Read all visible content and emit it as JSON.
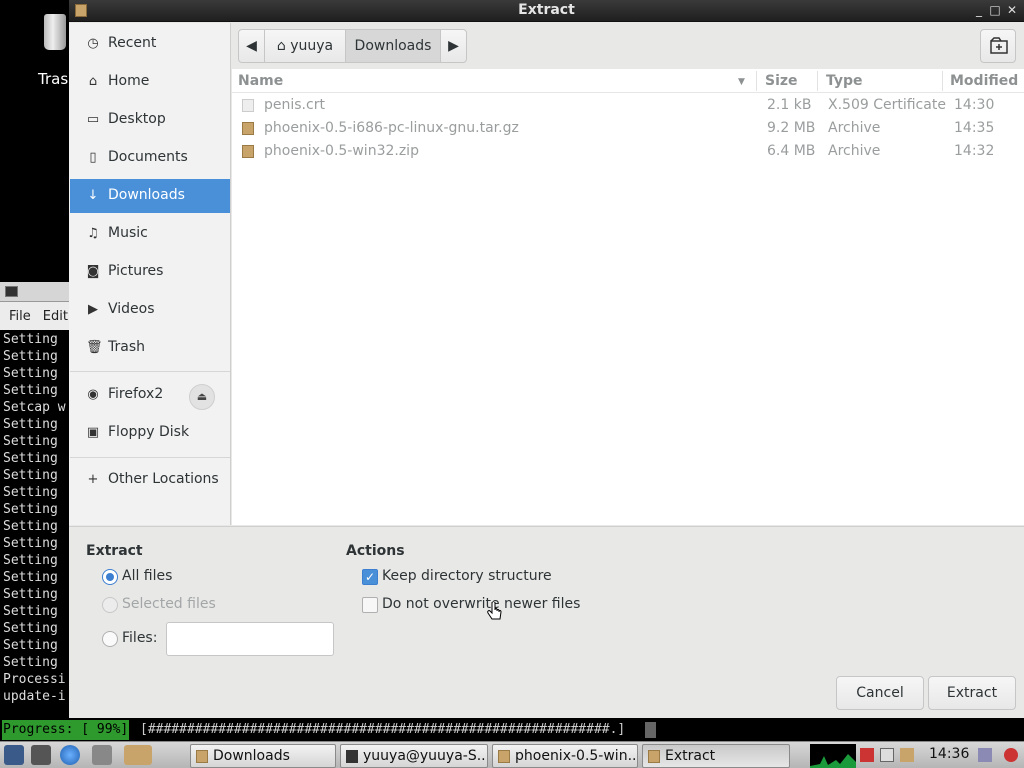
{
  "desktop": {
    "trash_label": "Trash"
  },
  "terminal": {
    "menu": [
      "File",
      "Edit"
    ],
    "lines": [
      "Setting",
      "Setting",
      "Setting",
      "Setting",
      "Setcap w",
      "Setting",
      "Setting",
      "Setting",
      "Setting",
      "Setting",
      "Setting",
      "Setting",
      "Setting",
      "Setting",
      "Setting",
      "Setting",
      "Setting",
      "Setting",
      "Setting",
      "Setting",
      "Processi",
      "update-i"
    ],
    "progress_label": "Progress: [ 99%]",
    "progress_bar": "[###########################################################.]",
    "progress_value": 0.99
  },
  "dialog": {
    "title": "Extract",
    "sidebar": {
      "items": [
        {
          "label": "Recent",
          "icon": "clock-icon"
        },
        {
          "label": "Home",
          "icon": "home-icon"
        },
        {
          "label": "Desktop",
          "icon": "folder-icon"
        },
        {
          "label": "Documents",
          "icon": "document-icon"
        },
        {
          "label": "Downloads",
          "icon": "download-icon",
          "selected": true
        },
        {
          "label": "Music",
          "icon": "music-icon"
        },
        {
          "label": "Pictures",
          "icon": "camera-icon"
        },
        {
          "label": "Videos",
          "icon": "video-icon"
        },
        {
          "label": "Trash",
          "icon": "trash-icon"
        }
      ],
      "devices": [
        {
          "label": "Firefox2",
          "icon": "disc-icon",
          "ejectable": true
        },
        {
          "label": "Floppy Disk",
          "icon": "floppy-icon"
        }
      ],
      "other": {
        "label": "Other Locations",
        "icon": "plus-icon"
      }
    },
    "pathbar": {
      "segments": [
        "yuuya",
        "Downloads"
      ],
      "active": "Downloads"
    },
    "filelist": {
      "columns": {
        "name": "Name",
        "size": "Size",
        "type": "Type",
        "modified": "Modified"
      },
      "sort_column": "Name",
      "rows": [
        {
          "name": "penis.crt",
          "size": "2.1 kB",
          "type": "X.509 Certificate",
          "modified": "14:30",
          "icon": "document-icon"
        },
        {
          "name": "phoenix-0.5-i686-pc-linux-gnu.tar.gz",
          "size": "9.2 MB",
          "type": "Archive",
          "modified": "14:35",
          "icon": "archive-icon"
        },
        {
          "name": "phoenix-0.5-win32.zip",
          "size": "6.4 MB",
          "type": "Archive",
          "modified": "14:32",
          "icon": "archive-icon"
        }
      ]
    },
    "extract_options": {
      "heading": "Extract",
      "all_files": "All files",
      "selected_files": "Selected files",
      "files": "Files:",
      "files_value": "",
      "selected": "All files"
    },
    "actions": {
      "heading": "Actions",
      "keep_dir": {
        "label": "Keep directory structure",
        "checked": true
      },
      "no_overwrite": {
        "label": "Do not overwrite newer files",
        "checked": false
      }
    },
    "buttons": {
      "cancel": "Cancel",
      "extract": "Extract"
    }
  },
  "taskbar": {
    "tasks": [
      {
        "label": "Downloads",
        "active": false
      },
      {
        "label": "yuuya@yuuya-S...",
        "active": false
      },
      {
        "label": "phoenix-0.5-win...",
        "active": false
      },
      {
        "label": "Extract",
        "active": true
      }
    ],
    "clock": "14:36"
  }
}
